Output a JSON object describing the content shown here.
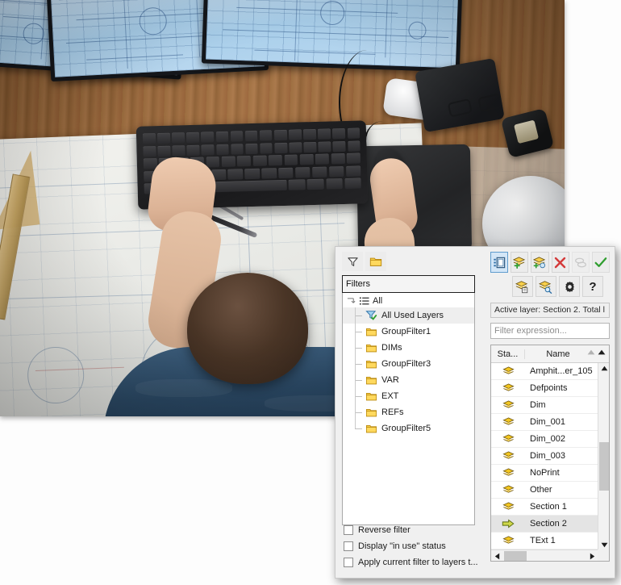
{
  "background": {
    "description": "Overhead photo of an engineer at a wooden desk working on CAD blueprints with two widescreen monitors, keyboard, mouse on a pad, drafting tools, 3D-printed part, hard hat and tape measure"
  },
  "dialog": {
    "left_toolbar": [
      {
        "name": "new-property-filter-icon",
        "glyph": "funnel"
      },
      {
        "name": "new-group-filter-icon",
        "glyph": "folder"
      }
    ],
    "filters_group_label": "Filters",
    "tree": {
      "root_label": "All",
      "items": [
        {
          "label": "All Used Layers",
          "icon": "funnel-check-icon",
          "selected": true
        },
        {
          "label": "GroupFilter1",
          "icon": "folder-icon",
          "selected": false
        },
        {
          "label": "DIMs",
          "icon": "folder-icon",
          "selected": false
        },
        {
          "label": "GroupFilter3",
          "icon": "folder-icon",
          "selected": false
        },
        {
          "label": "VAR",
          "icon": "folder-icon",
          "selected": false
        },
        {
          "label": "EXT",
          "icon": "folder-icon",
          "selected": false
        },
        {
          "label": "REFs",
          "icon": "folder-icon",
          "selected": false
        },
        {
          "label": "GroupFilter5",
          "icon": "folder-icon",
          "selected": false
        }
      ]
    },
    "checkboxes": [
      {
        "label": "Reverse filter",
        "checked": false
      },
      {
        "label": "Display \"in use\" status",
        "checked": false
      },
      {
        "label": "Apply current filter to layers t...",
        "checked": false
      }
    ],
    "right_toolbar_row1": [
      {
        "name": "layer-properties-panel-toggle-icon",
        "state": "active"
      },
      {
        "name": "new-layer-icon",
        "state": "normal"
      },
      {
        "name": "new-layer-frozen-in-viewports-icon",
        "state": "normal"
      },
      {
        "name": "delete-layer-icon",
        "state": "normal"
      },
      {
        "name": "merge-layers-icon",
        "state": "disabled"
      },
      {
        "name": "set-current-layer-icon",
        "state": "normal"
      }
    ],
    "right_toolbar_row2": [
      {
        "name": "layer-states-manager-icon",
        "state": "normal"
      },
      {
        "name": "layer-isolate-search-icon",
        "state": "normal"
      },
      {
        "name": "settings-gear-icon",
        "state": "normal"
      },
      {
        "name": "help-icon",
        "state": "normal"
      }
    ],
    "status_text": "Active layer: Section 2. Total l",
    "filter_expression_placeholder": "Filter expression...",
    "filter_expression_value": "",
    "list": {
      "columns": [
        "Sta...",
        "Name"
      ],
      "rows": [
        {
          "status": "layer",
          "name": "Amphit...er_105",
          "current": false
        },
        {
          "status": "layer",
          "name": "Defpoints",
          "current": false
        },
        {
          "status": "layer",
          "name": "Dim",
          "current": false
        },
        {
          "status": "layer",
          "name": "Dim_001",
          "current": false
        },
        {
          "status": "layer",
          "name": "Dim_002",
          "current": false
        },
        {
          "status": "layer",
          "name": "Dim_003",
          "current": false
        },
        {
          "status": "layer",
          "name": "NoPrint",
          "current": false
        },
        {
          "status": "layer",
          "name": "Other",
          "current": false
        },
        {
          "status": "layer",
          "name": "Section 1",
          "current": false
        },
        {
          "status": "current",
          "name": "Section 2",
          "current": true
        },
        {
          "status": "layer",
          "name": "TExt 1",
          "current": false
        }
      ]
    }
  },
  "colors": {
    "accent_blue": "#5f9cce",
    "layer_yellow": "#f0c419",
    "check_green": "#3aa03a",
    "delete_red": "#d03a3a",
    "panel_bg": "#f0f0f0"
  }
}
